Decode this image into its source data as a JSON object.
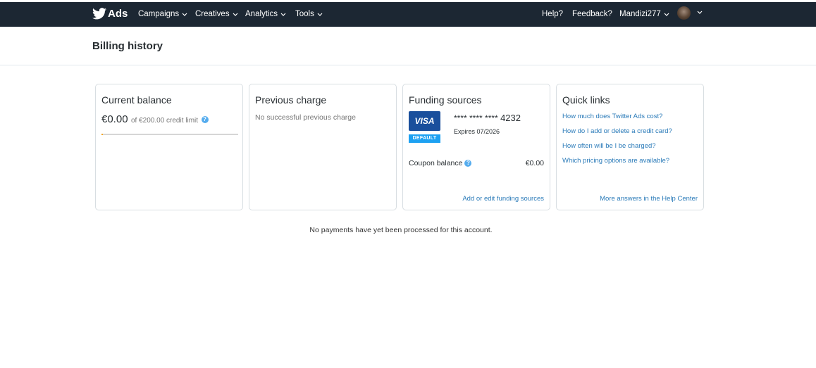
{
  "nav": {
    "brand": "Ads",
    "menus": [
      {
        "label": "Campaigns"
      },
      {
        "label": "Creatives"
      },
      {
        "label": "Analytics"
      },
      {
        "label": "Tools"
      }
    ],
    "help": "Help?",
    "feedback": "Feedback?",
    "username": "Mandizi277"
  },
  "page": {
    "title": "Billing history",
    "empty_message": "No payments have yet been processed for this account."
  },
  "current_balance": {
    "title": "Current balance",
    "amount": "€0.00",
    "limit_text": "of €200.00 credit limit",
    "used_fraction": 0.0
  },
  "previous_charge": {
    "title": "Previous charge",
    "text": "No successful previous charge"
  },
  "funding_sources": {
    "title": "Funding sources",
    "card_brand": "VISA",
    "default_badge": "DEFAULT",
    "masked_digits": "**** **** ****",
    "last4": "4232",
    "expires": "Expires 07/2026",
    "coupon_label": "Coupon balance",
    "coupon_value": "€0.00",
    "edit_link": "Add or edit funding sources"
  },
  "quick_links": {
    "title": "Quick links",
    "links": [
      {
        "label": "How much does Twitter Ads cost?"
      },
      {
        "label": "How do I add or delete a credit card?"
      },
      {
        "label": "How often will be I be charged?"
      },
      {
        "label": "Which pricing options are available?"
      }
    ],
    "more_link": "More answers in the Help Center"
  },
  "colors": {
    "topbar": "#1c2733",
    "link": "#2b7bb9",
    "visa": "#1a4f9c",
    "default_badge": "#1da1f2",
    "help_icon": "#55acee",
    "progress_fill": "#f5a623"
  }
}
